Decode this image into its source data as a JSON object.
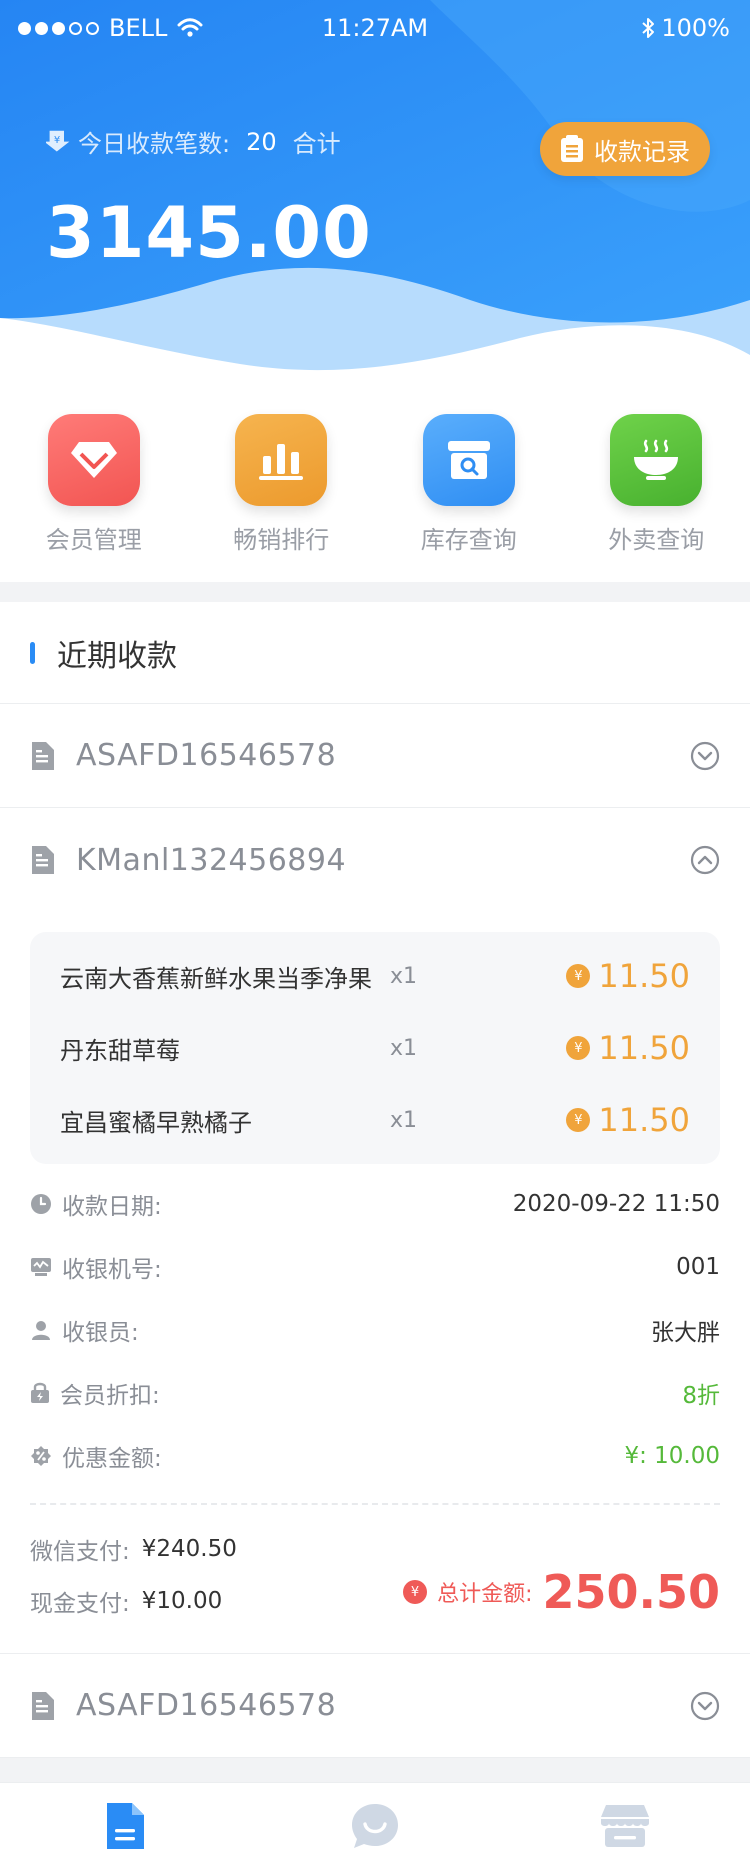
{
  "status_bar": {
    "carrier": "BELL",
    "time": "11:27AM",
    "battery": "100%"
  },
  "header": {
    "today_label": "今日收款笔数:",
    "today_count": "20",
    "total_label": "合计",
    "total_amount": "3145.00",
    "records_button": "收款记录"
  },
  "quick_nav": [
    {
      "label": "会员管理",
      "icon": "diamond-icon",
      "color": "#f3605f"
    },
    {
      "label": "畅销排行",
      "icon": "bar-chart-icon",
      "color": "#f0a43b"
    },
    {
      "label": "库存查询",
      "icon": "inventory-search-icon",
      "color": "#3d9cf6"
    },
    {
      "label": "外卖查询",
      "icon": "bowl-icon",
      "color": "#55c23a"
    }
  ],
  "recent": {
    "title": "近期收款",
    "orders": [
      {
        "id": "ASAFD16546578",
        "expanded": false
      },
      {
        "id": "KManl132456894",
        "expanded": true
      },
      {
        "id": "ASAFD16546578",
        "expanded": false
      }
    ],
    "items": [
      {
        "name": "云南大香蕉新鲜水果当季净果",
        "qty": "x1",
        "price": "11.50"
      },
      {
        "name": "丹东甜草莓",
        "qty": "x1",
        "price": "11.50"
      },
      {
        "name": "宜昌蜜橘早熟橘子",
        "qty": "x1",
        "price": "11.50"
      }
    ],
    "details": {
      "date_label": "收款日期:",
      "date_value": "2020-09-22  11:50",
      "terminal_label": "收银机号:",
      "terminal_value": "001",
      "cashier_label": "收银员:",
      "cashier_value": "张大胖",
      "discount_label": "会员折扣:",
      "discount_value": "8折",
      "coupon_label": "优惠金额:",
      "coupon_value": "¥: 10.00"
    },
    "payment": {
      "wechat_label": "微信支付:",
      "wechat_value": "¥240.50",
      "cash_label": "现金支付:",
      "cash_value": "¥10.00",
      "grand_label": "总计金额:",
      "grand_value": "250.50"
    }
  },
  "tabbar": [
    {
      "icon": "receipt-icon",
      "active": true
    },
    {
      "icon": "chat-icon",
      "active": false
    },
    {
      "icon": "store-icon",
      "active": false
    }
  ],
  "colors": {
    "primary": "#2a8cf5",
    "orange": "#f0a43b",
    "red": "#ef5a57",
    "green": "#55b93a"
  }
}
